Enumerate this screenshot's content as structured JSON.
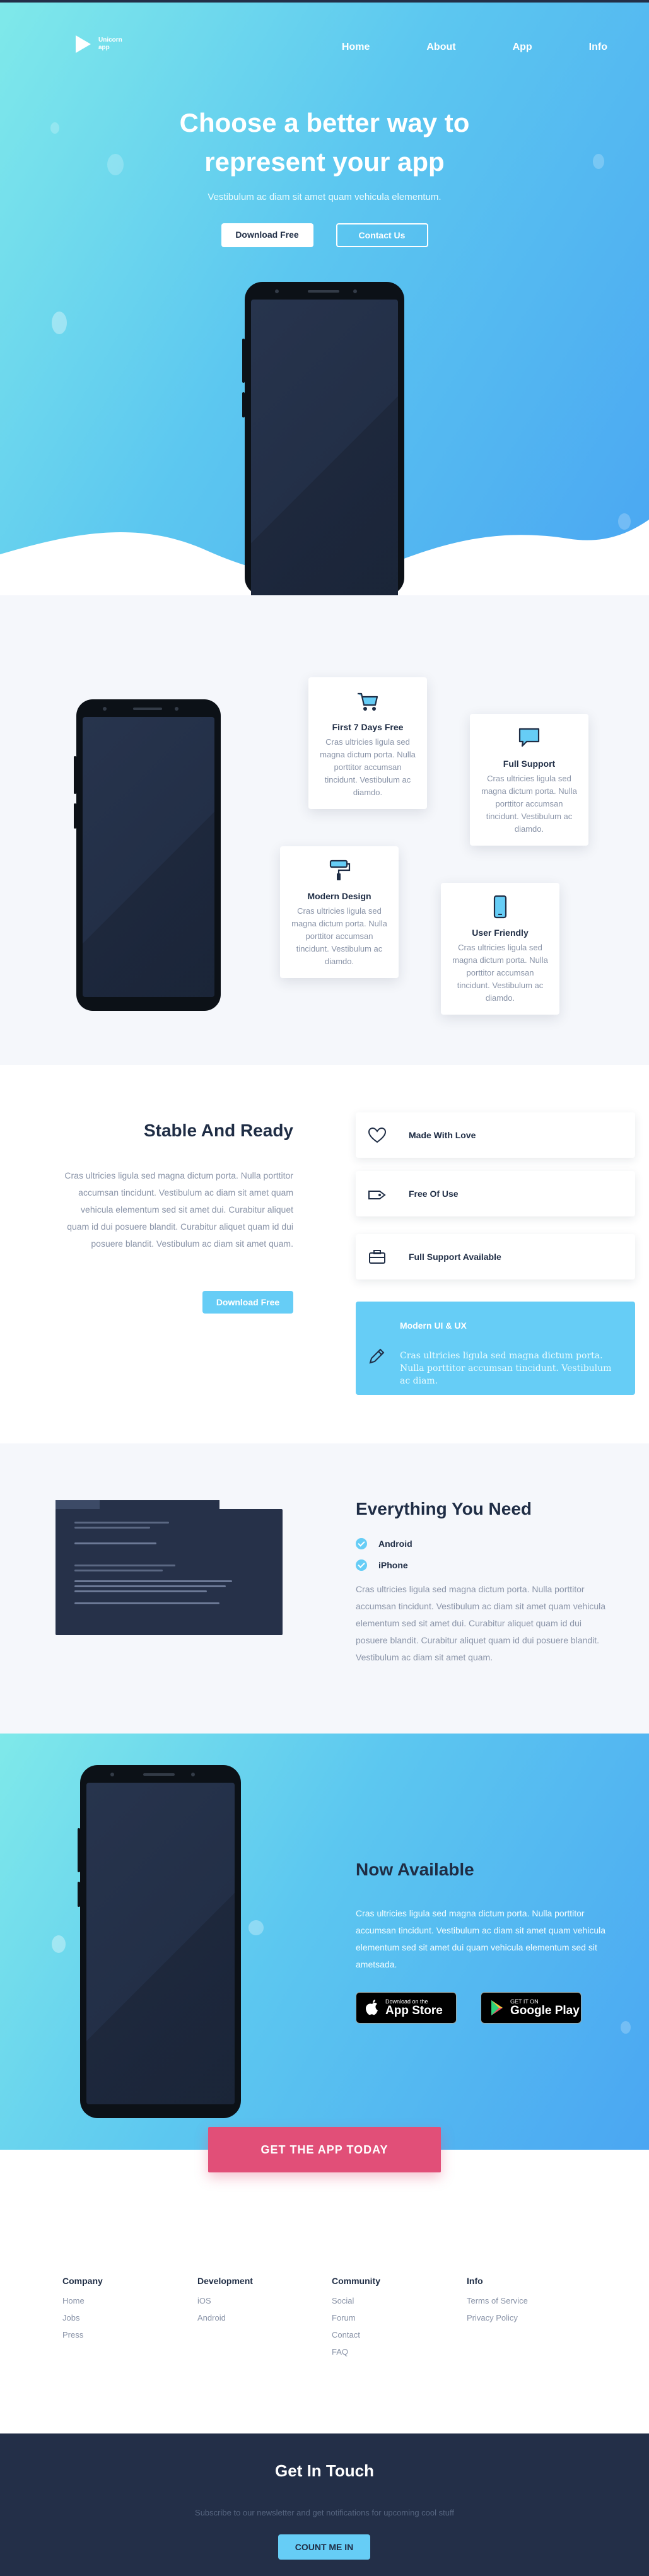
{
  "brand": {
    "line1": "Unicorn",
    "line2": "app"
  },
  "nav": [
    "Home",
    "About",
    "App",
    "Info"
  ],
  "hero": {
    "title_line1": "Choose a better way to",
    "title_line2": "represent your app",
    "subtitle": "Vestibulum ac diam sit amet quam vehicula elementum.",
    "primary_button": "Download Free",
    "secondary_button": "Contact Us"
  },
  "features": [
    {
      "title": "First 7 Days Free",
      "text": "Cras ultricies ligula sed magna dictum porta. Nulla porttitor accumsan tincidunt. Vestibulum ac diamdo.",
      "icon": "cart-icon"
    },
    {
      "title": "Full Support",
      "text": "Cras ultricies ligula sed magna dictum porta. Nulla porttitor accumsan tincidunt. Vestibulum ac diamdo.",
      "icon": "chat-icon"
    },
    {
      "title": "Modern Design",
      "text": "Cras ultricies ligula sed magna dictum porta. Nulla porttitor accumsan tincidunt. Vestibulum ac diamdo.",
      "icon": "paint-roller-icon"
    },
    {
      "title": "User Friendly",
      "text": "Cras ultricies ligula sed magna dictum porta. Nulla porttitor accumsan tincidunt. Vestibulum ac diamdo.",
      "icon": "smartphone-icon"
    }
  ],
  "stable": {
    "title": "Stable And Ready",
    "text": "Cras ultricies ligula sed magna dictum porta. Nulla porttitor accumsan tincidunt. Vestibulum ac diam sit amet quam vehicula elementum sed sit amet dui. Curabitur aliquet quam id dui posuere blandit. Curabitur aliquet quam id dui posuere blandit. Vestibulum ac diam sit amet quam.",
    "button": "Download Free",
    "items": [
      "Made With Love",
      "Free Of Use",
      "Full Support Available"
    ],
    "active": {
      "title": "Modern UI & UX",
      "text": "Cras ultricies ligula sed magna dictum porta. Nulla porttitor accumsan tincidunt. Vestibulum ac diam."
    }
  },
  "everything": {
    "title": "Everything You Need",
    "checks": [
      "Android",
      "iPhone"
    ],
    "text": "Cras ultricies ligula sed magna dictum porta. Nulla porttitor accumsan tincidunt. Vestibulum ac diam sit amet quam vehicula elementum sed sit amet dui. Curabitur aliquet quam id dui posuere blandit. Curabitur aliquet quam id dui posuere blandit. Vestibulum ac diam sit amet quam."
  },
  "available": {
    "title": "Now Available",
    "text": "Cras ultricies ligula sed magna dictum porta. Nulla porttitor accumsan tincidunt. Vestibulum ac diam sit amet quam vehicula elementum sed sit amet dui quam vehicula elementum sed sit ametsada.",
    "appstore_small": "Download on the",
    "appstore_big": "App Store",
    "googleplay_small": "GET IT ON",
    "googleplay_big": "Google Play",
    "cta": "GET THE APP TODAY"
  },
  "footer": {
    "columns": [
      {
        "title": "Company",
        "links": [
          "Home",
          "Jobs",
          "Press"
        ]
      },
      {
        "title": "Development",
        "links": [
          "iOS",
          "Android"
        ]
      },
      {
        "title": "Community",
        "links": [
          "Social",
          "Forum",
          "Contact",
          "FAQ"
        ]
      },
      {
        "title": "Info",
        "links": [
          "Terms of Service",
          "Privacy Policy"
        ]
      }
    ]
  },
  "contact": {
    "title": "Get In Touch",
    "text": "Subscribe to our newsletter and get notifications for upcoming cool stuff",
    "button": "COUNT ME IN"
  },
  "colors": {
    "accent": "#66cdf6",
    "dark": "#232f48",
    "cta": "#e14f78",
    "text_muted": "#8a94a8"
  }
}
